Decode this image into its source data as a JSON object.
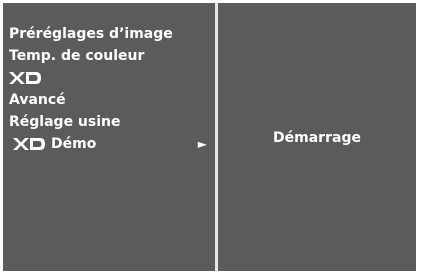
{
  "menu": {
    "items": [
      {
        "label": "Préréglages d’image"
      },
      {
        "label": "Temp. de couleur"
      },
      {
        "logo": "XD",
        "icon": "xd-logo-icon"
      },
      {
        "label": "Avancé"
      },
      {
        "label": "Réglage usine"
      },
      {
        "label": "Démo",
        "logo": "XD",
        "icon": "xd-logo-icon",
        "arrow": "►",
        "selected": true
      }
    ]
  },
  "submenu": {
    "items": [
      {
        "label": "Démarrage"
      }
    ]
  },
  "colors": {
    "panel_bg": "#5b5b5b",
    "divider": "#e6e6e6",
    "text": "#ffffff"
  }
}
